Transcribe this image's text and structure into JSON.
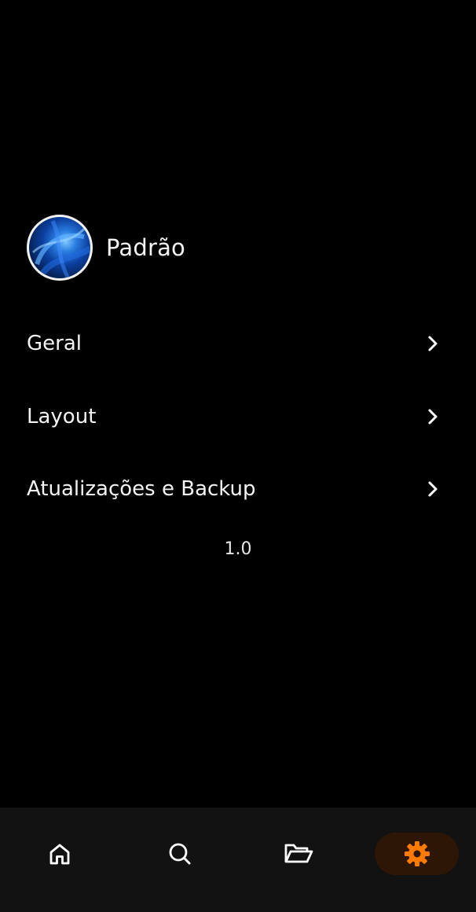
{
  "profile": {
    "name": "Padrão",
    "avatar_icon": "abstract-blue-wallpaper"
  },
  "menu": {
    "items": [
      {
        "label": "Geral",
        "icon": "chevron-right-icon"
      },
      {
        "label": "Layout",
        "icon": "chevron-right-icon"
      },
      {
        "label": "Atualizações e Backup",
        "icon": "chevron-right-icon"
      }
    ]
  },
  "version": "1.0",
  "bottom_nav": {
    "items": [
      {
        "icon": "home-icon",
        "active": false
      },
      {
        "icon": "search-icon",
        "active": false
      },
      {
        "icon": "folder-open-icon",
        "active": false
      },
      {
        "icon": "gear-icon",
        "active": true
      }
    ],
    "active_color": "#ff7a00",
    "active_background": "#2e1606"
  },
  "colors": {
    "background": "#000000",
    "nav_background": "#121212",
    "text": "#f4f4f4"
  }
}
